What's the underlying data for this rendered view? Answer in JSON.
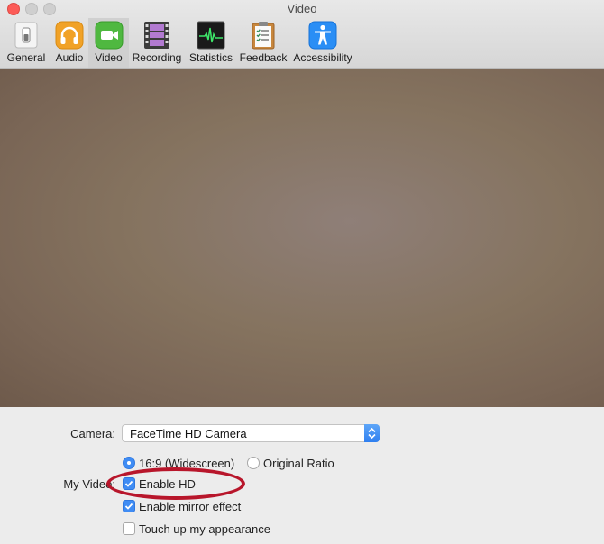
{
  "window": {
    "title": "Video"
  },
  "toolbar": {
    "items": [
      {
        "label": "General",
        "icon": "general-switch-icon"
      },
      {
        "label": "Audio",
        "icon": "headphones-icon"
      },
      {
        "label": "Video",
        "icon": "video-camera-icon",
        "selected": true
      },
      {
        "label": "Recording",
        "icon": "film-strip-icon"
      },
      {
        "label": "Statistics",
        "icon": "waveform-icon"
      },
      {
        "label": "Feedback",
        "icon": "clipboard-icon"
      },
      {
        "label": "Accessibility",
        "icon": "accessibility-icon"
      }
    ]
  },
  "settings": {
    "camera_label": "Camera:",
    "camera_value": "FaceTime HD Camera",
    "my_video_label": "My Video:",
    "ratio_widescreen": "16:9 (Widescreen)",
    "ratio_original": "Original Ratio",
    "enable_hd": "Enable HD",
    "mirror": "Enable mirror effect",
    "touch_up": "Touch up my appearance",
    "ratio_selected": "16:9 (Widescreen)",
    "enable_hd_checked": true,
    "mirror_checked": true,
    "touch_up_checked": false
  },
  "colors": {
    "accent": "#3f8cf4",
    "annotation": "#b8162b"
  }
}
